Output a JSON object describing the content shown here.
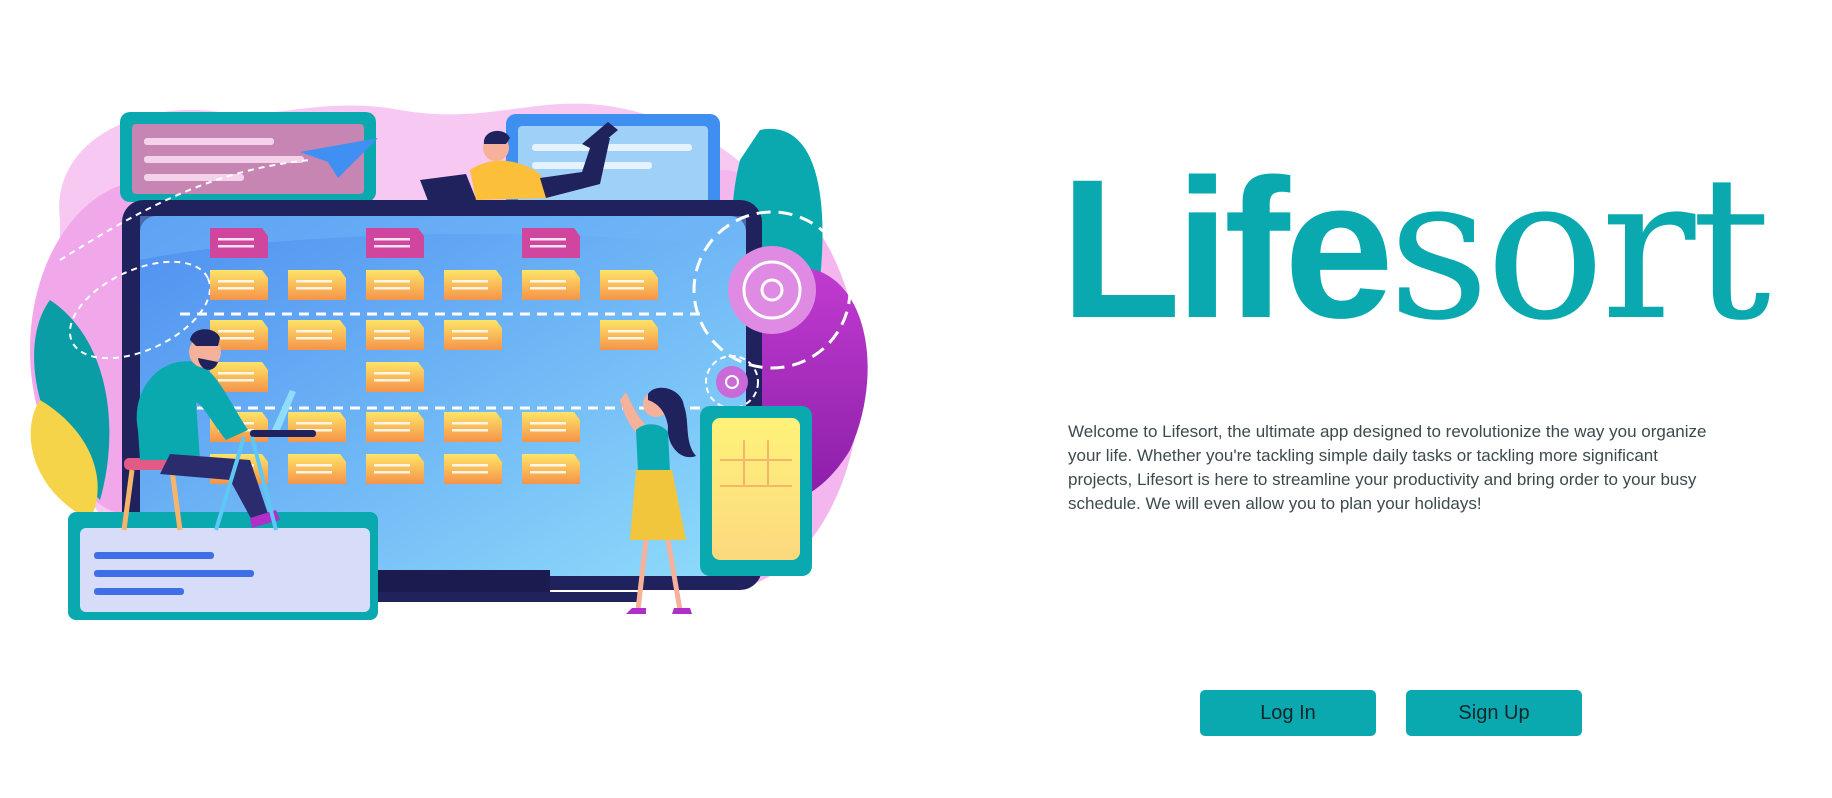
{
  "brand": {
    "title_part1": "Life",
    "title_part2": "sort",
    "accent_color": "#0aa9b0"
  },
  "intro": {
    "text": "Welcome to Lifesort, the ultimate app designed to revolutionize the way you organize your life. Whether you're tackling simple daily tasks or tackling more significant projects, Lifesort is here to streamline your productivity and bring order to your busy schedule. We will even allow you to plan your holidays!"
  },
  "actions": {
    "login_label": "Log In",
    "signup_label": "Sign Up"
  },
  "illustration": {
    "subject": "task-board-illustration",
    "colors": {
      "teal": "#0aa9b0",
      "pink": "#f3a6ea",
      "purple": "#b02fc9",
      "navy": "#20225e",
      "screen_blue": "#5ba8f5",
      "note_orange": "#f6a04d",
      "note_magenta": "#d0469f",
      "yellow": "#fde468"
    }
  }
}
